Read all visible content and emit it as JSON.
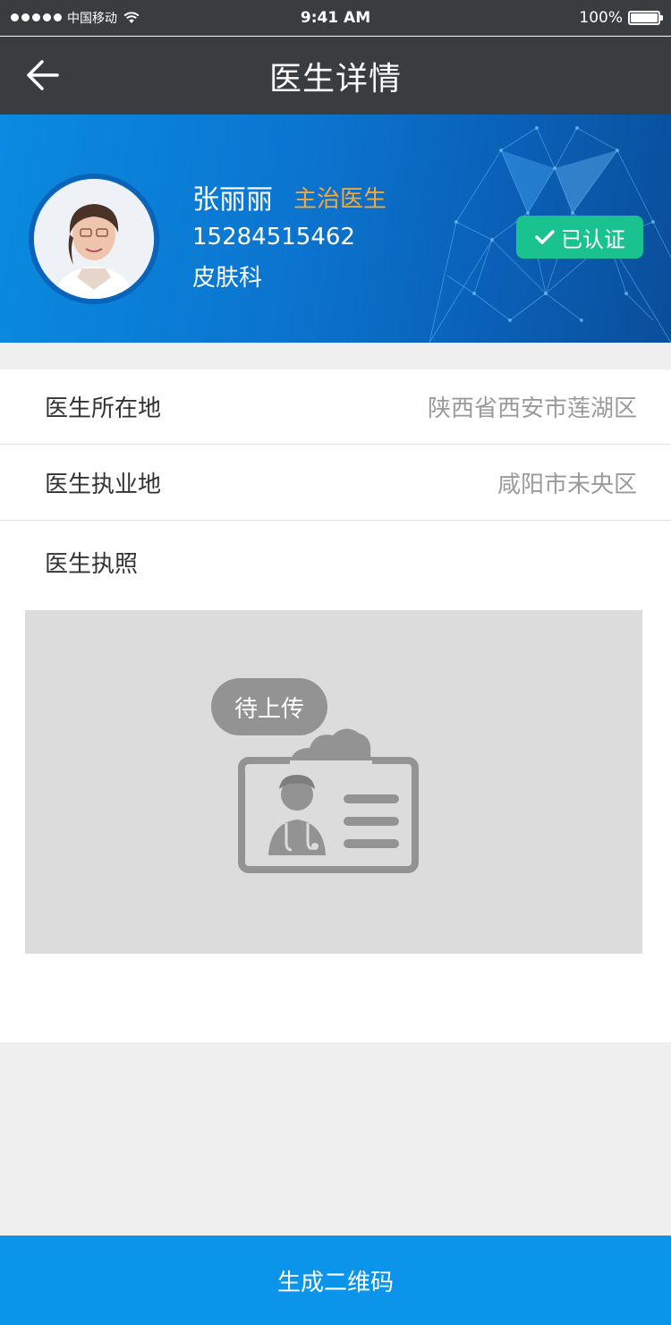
{
  "status_bar": {
    "carrier": "中国移动",
    "time": "9:41 AM",
    "battery": "100%"
  },
  "nav": {
    "title": "医生详情"
  },
  "doctor": {
    "name": "张丽丽",
    "title": "主治医生",
    "phone": "15284515462",
    "department": "皮肤科",
    "verified_label": "已认证"
  },
  "info": {
    "rows": [
      {
        "label": "医生所在地",
        "value": "陕西省西安市莲湖区"
      },
      {
        "label": "医生执业地",
        "value": "咸阳市未央区"
      }
    ],
    "license_label": "医生执照",
    "license_status": "待上传"
  },
  "actions": {
    "generate_qr_label": "生成二维码"
  },
  "colors": {
    "nav_bg": "#3a3d40",
    "banner_blue": "#0b74cf",
    "title_orange": "#f3a83a",
    "verified_green": "#19c28f",
    "primary_button": "#0a95ea"
  }
}
